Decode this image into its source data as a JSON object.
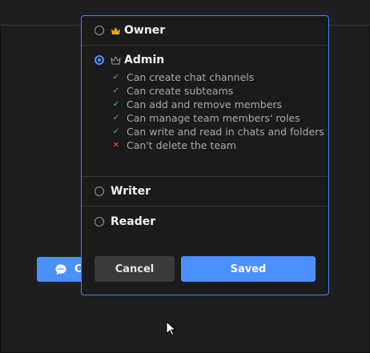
{
  "background": {
    "chat_button_label": "C"
  },
  "dialog": {
    "roles": [
      {
        "label": "Owner",
        "selected": false,
        "icon": "crown-icon"
      },
      {
        "label": "Admin",
        "selected": true,
        "icon": "crown-outline-icon"
      },
      {
        "label": "Writer",
        "selected": false
      },
      {
        "label": "Reader",
        "selected": false
      }
    ],
    "admin_permissions": [
      {
        "text": "Can create chat channels",
        "allowed": true
      },
      {
        "text": "Can create subteams",
        "allowed": true
      },
      {
        "text": "Can add and remove members",
        "allowed": true
      },
      {
        "text": "Can manage team members' roles",
        "allowed": true
      },
      {
        "text": "Can write and read in chats and folders",
        "allowed": true
      },
      {
        "text": "Can't delete the team",
        "allowed": false
      }
    ],
    "cancel_label": "Cancel",
    "save_label": "Saved"
  },
  "colors": {
    "accent": "#4a90ff",
    "check": "#3cc36b",
    "cross": "#ff4a4a",
    "crown": "#f5a623"
  }
}
